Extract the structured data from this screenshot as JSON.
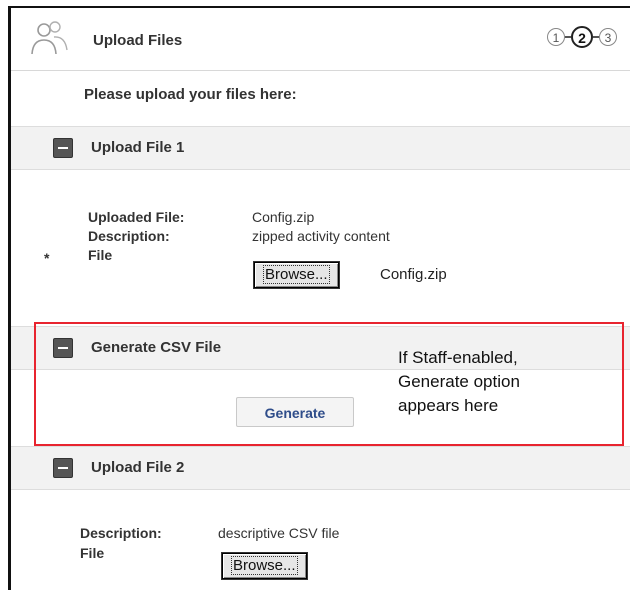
{
  "header": {
    "title": "Upload Files",
    "icon": "users-icon",
    "steps": [
      "1",
      "2",
      "3"
    ],
    "active_step": "2"
  },
  "intro": "Please upload your files here:",
  "sections": {
    "upload1": {
      "title": "Upload File 1",
      "uploaded_label": "Uploaded File:",
      "uploaded_value": "Config.zip",
      "description_label": "Description:",
      "description_value": "zipped activity content",
      "required_mark": "*",
      "file_label": "File",
      "browse_label": "Browse...",
      "file_name": "Config.zip"
    },
    "generate": {
      "title": "Generate CSV File",
      "button_label": "Generate"
    },
    "upload2": {
      "title": "Upload File 2",
      "description_label": "Description:",
      "description_value": "descriptive CSV file",
      "file_label": "File",
      "browse_label": "Browse..."
    }
  },
  "callout": {
    "text": "If Staff-enabled,\nGenerate option\nappears here",
    "border_color": "#e8242f"
  }
}
